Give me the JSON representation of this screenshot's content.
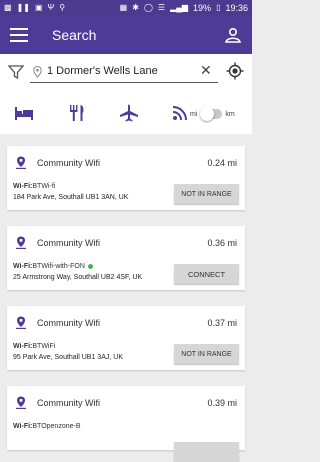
{
  "status_bar": {
    "time": "19:36",
    "battery": "19%"
  },
  "app_bar": {
    "title": "Search",
    "menu_icon": "menu-icon",
    "profile_icon": "profile-icon"
  },
  "filter_bar": {
    "location_value": "1 Dormer's Wells Lane",
    "units": {
      "left": "mi",
      "right": "km"
    },
    "categories": [
      "bed-icon",
      "restaurant-icon",
      "airplane-icon",
      "wifi-icon"
    ]
  },
  "results": [
    {
      "title": "Community Wifi",
      "distance": "0.24 mi",
      "ssid_prefix": "Wi-Fi:",
      "ssid": "BTWi-fi",
      "online": false,
      "address": "184 Park Ave, Southall UB1 3AN, UK",
      "action": "NOT IN RANGE"
    },
    {
      "title": "Community Wifi",
      "distance": "0.36 mi",
      "ssid_prefix": "Wi-Fi:",
      "ssid": "BTWifi-with-FON",
      "online": true,
      "address": "25 Armstrong Way, Southall UB2 4SF, UK",
      "action": "CONNECT"
    },
    {
      "title": "Community Wifi",
      "distance": "0.37 mi",
      "ssid_prefix": "Wi-Fi:",
      "ssid": "BTWiFi",
      "online": false,
      "address": "95 Park Ave, Southall UB1 3AJ, UK",
      "action": "NOT IN RANGE"
    },
    {
      "title": "Community Wifi",
      "distance": "0.39 mi",
      "ssid_prefix": "Wi-Fi:",
      "ssid": "BTOpenzone-B",
      "online": false,
      "address": "",
      "action": ""
    }
  ],
  "colors": {
    "primary": "#4e3b97",
    "pin": "#4e3b97",
    "online": "#4caf50"
  }
}
